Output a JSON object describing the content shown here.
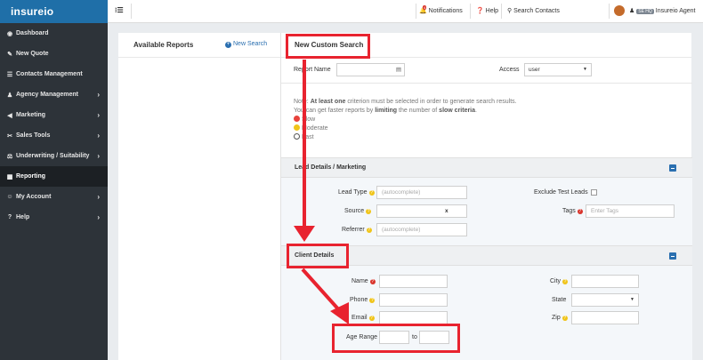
{
  "brand": {
    "logo_text": "insureio"
  },
  "sidebar": {
    "items": [
      {
        "icon": "dashboard-icon",
        "glyph": "◉",
        "label": "Dashboard",
        "chevron": false
      },
      {
        "icon": "pencil-icon",
        "glyph": "✎",
        "label": "New Quote",
        "chevron": false
      },
      {
        "icon": "contacts-icon",
        "glyph": "☰",
        "label": "Contacts Management",
        "chevron": false
      },
      {
        "icon": "agency-icon",
        "glyph": "♟",
        "label": "Agency Management",
        "chevron": true
      },
      {
        "icon": "bullhorn-icon",
        "glyph": "◀",
        "label": "Marketing",
        "chevron": true
      },
      {
        "icon": "tools-icon",
        "glyph": "✂",
        "label": "Sales Tools",
        "chevron": true
      },
      {
        "icon": "underwriting-icon",
        "glyph": "⚖",
        "label": "Underwriting / Suitability",
        "chevron": true
      },
      {
        "icon": "chart-icon",
        "glyph": "▦",
        "label": "Reporting",
        "chevron": false,
        "active": true
      },
      {
        "icon": "user-icon",
        "glyph": "☺",
        "label": "My Account",
        "chevron": true
      },
      {
        "icon": "help-icon",
        "glyph": "?",
        "label": "Help",
        "chevron": true
      }
    ]
  },
  "topbar": {
    "notifications_label": "Notifications",
    "notifications_count": "4",
    "help_label": "Help",
    "search_label": "Search Contacts",
    "role_badge": "SE HQ",
    "user_name": "Insureio Agent"
  },
  "reports": {
    "title": "Available Reports",
    "new_search_label": "New Search"
  },
  "custom_search": {
    "title": "New Custom Search",
    "report_name_label": "Report Name",
    "access_label": "Access",
    "access_value": "user",
    "note_prefix": "Note: ",
    "note_bold1": "At least one",
    "note_mid": " criterion must be selected in order to generate search results.",
    "note_line2_prefix": "You can get faster reports by ",
    "note_bold2": "limiting",
    "note_line2_mid": " the number of ",
    "note_bold3": "slow criteria",
    "note_line2_end": ".",
    "legend": [
      {
        "color": "#e8423c",
        "label": "Slow"
      },
      {
        "color": "#f0c419",
        "label": "Moderate"
      },
      {
        "color": "#ffffff",
        "label": "Fast"
      }
    ]
  },
  "lead_section": {
    "title": "Lead Details / Marketing",
    "lead_type_label": "Lead Type",
    "lead_type_placeholder": "(autocomplete)",
    "source_label": "Source",
    "source_clear": "x",
    "referrer_label": "Referrer",
    "referrer_placeholder": "(autocomplete)",
    "exclude_test_label": "Exclude Test Leads",
    "tags_label": "Tags",
    "tags_placeholder": "Enter Tags"
  },
  "client_section": {
    "title": "Client Details",
    "name_label": "Name",
    "phone_label": "Phone",
    "email_label": "Email",
    "age_range_label": "Age Range",
    "age_to_label": "to",
    "city_label": "City",
    "state_label": "State",
    "zip_label": "Zip"
  },
  "colors": {
    "sidebar_bg": "#2d3339",
    "brand_blue": "#1f6fa8",
    "link_blue": "#2a6fb0",
    "annotation_red": "#e8232f"
  }
}
